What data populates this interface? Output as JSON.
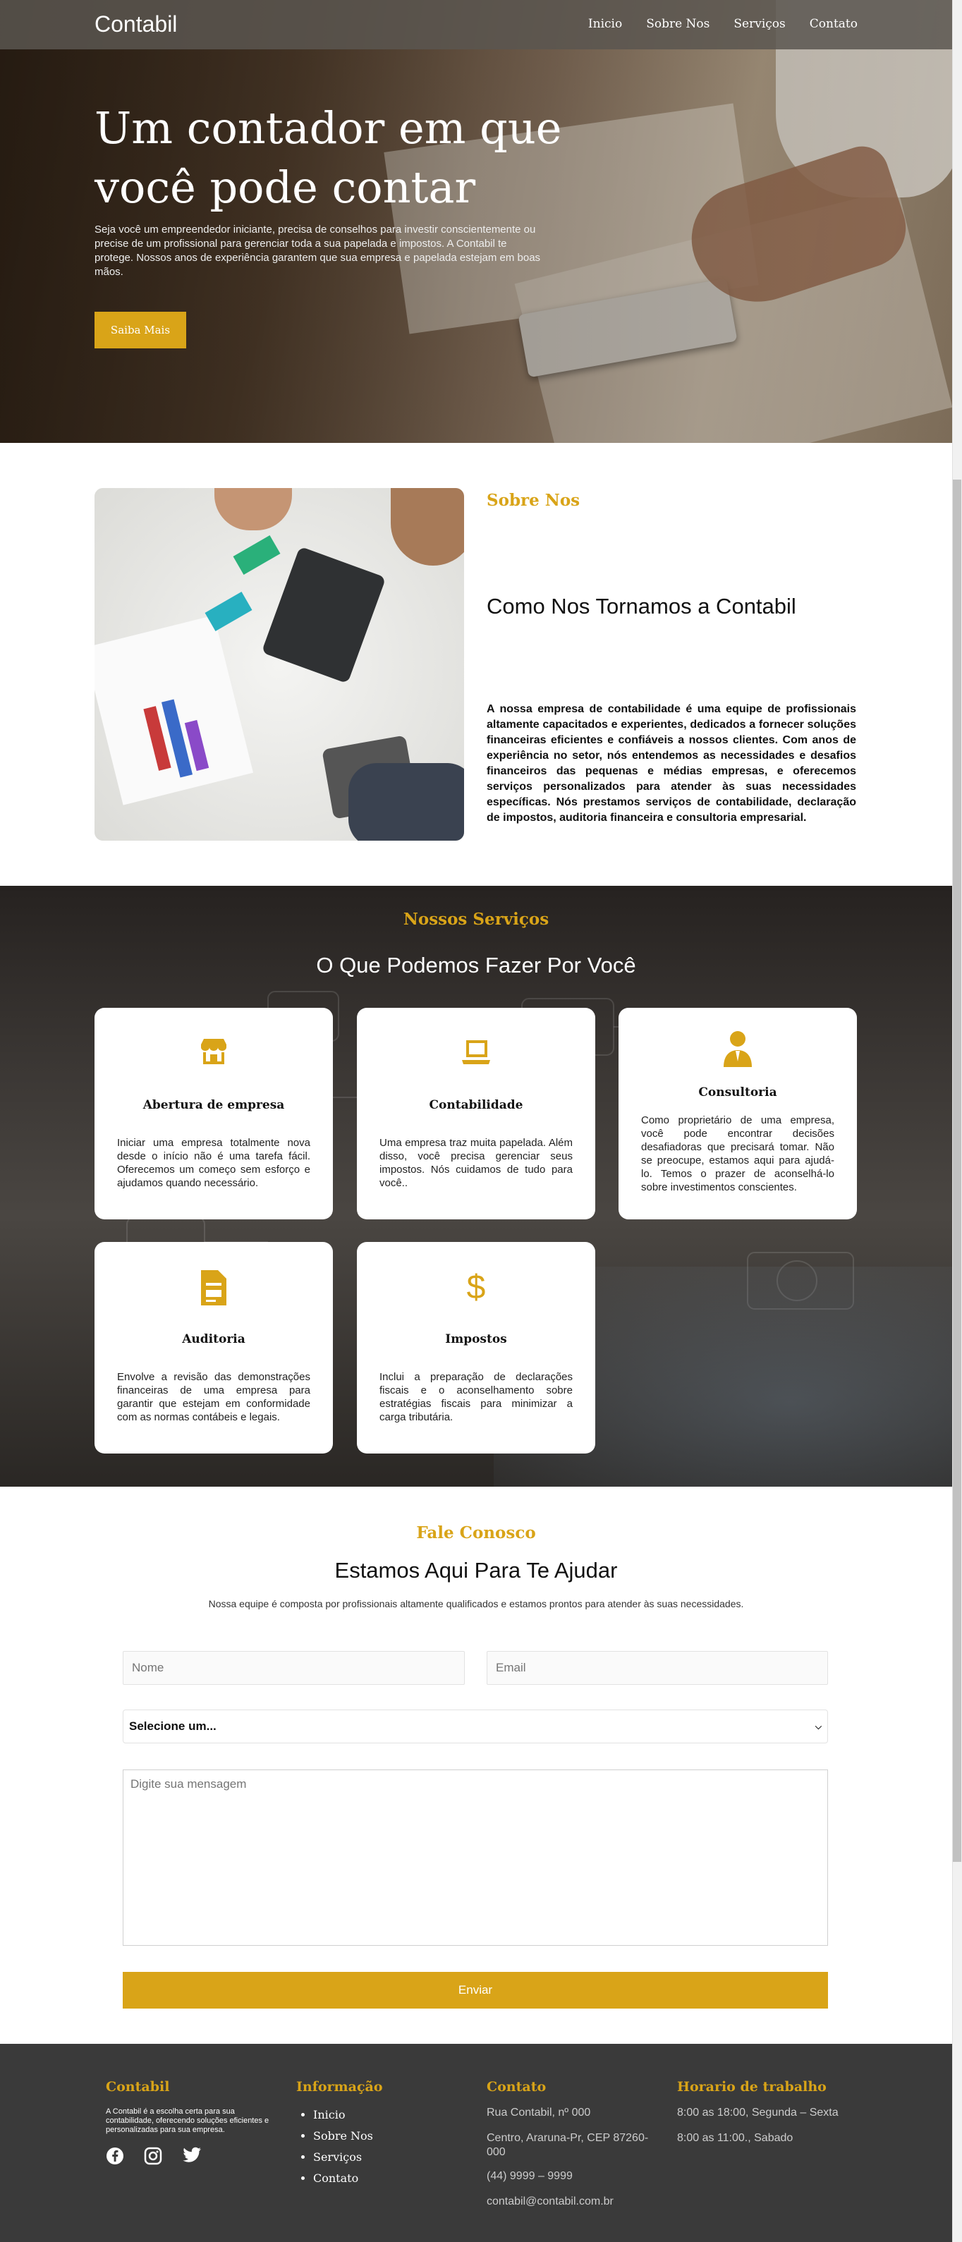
{
  "nav": {
    "brand": "Contabil",
    "links": [
      "Inicio",
      "Sobre Nos",
      "Serviços",
      "Contato"
    ]
  },
  "hero": {
    "title": "Um contador em que você pode contar",
    "text": "Seja você um empreendedor iniciante, precisa de conselhos para investir conscientemente ou precise de um profissional para gerenciar toda a sua papelada e impostos. A Contabil te protege. Nossos anos de experiência garantem que sua empresa e papelada estejam em boas mãos.",
    "button": "Saiba Mais"
  },
  "about": {
    "eyebrow": "Sobre Nos",
    "title": "Como Nos Tornamos a Contabil",
    "text": "A nossa empresa de contabilidade é uma equipe de profissionais altamente capacitados e experientes, dedicados a fornecer soluções financeiras eficientes e confiáveis a nossos clientes. Com anos de experiência no setor, nós entendemos as necessidades e desafios financeiros das pequenas e médias empresas, e oferecemos serviços personalizados para atender às suas necessidades específicas. Nós prestamos serviços de contabilidade, declaração de impostos, auditoria financeira e consultoria empresarial."
  },
  "services": {
    "eyebrow": "Nossos Serviços",
    "title": "O Que Podemos Fazer Por Você",
    "cards": [
      {
        "icon": "store-icon",
        "title": "Abertura de empresa",
        "text": "Iniciar uma empresa totalmente nova desde o início não é uma tarefa fácil. Oferecemos um começo sem esforço e ajudamos quando necessário."
      },
      {
        "icon": "laptop-icon",
        "title": "Contabilidade",
        "text": "Uma empresa traz muita papelada. Além disso, você precisa gerenciar seus impostos. Nós cuidamos de tudo para você.."
      },
      {
        "icon": "consultant-icon",
        "title": "Consultoria",
        "text": "Como proprietário de uma empresa, você pode encontrar decisões desafiadoras que precisará tomar. Não se preocupe, estamos aqui para ajudá-lo. Temos o prazer de aconselhá-lo sobre investimentos conscientes."
      },
      {
        "icon": "document-icon",
        "title": "Auditoria",
        "text": "Envolve a revisão das demonstrações financeiras de uma empresa para garantir que estejam em conformidade com as normas contábeis e legais."
      },
      {
        "icon": "dollar-icon",
        "title": "Impostos",
        "text": "Inclui a preparação de declarações fiscais e o aconselhamento sobre estratégias fiscais para minimizar a carga tributária."
      }
    ]
  },
  "contact": {
    "eyebrow": "Fale Conosco",
    "title": "Estamos Aqui Para Te Ajudar",
    "text": "Nossa equipe é composta por profissionais altamente qualificados e estamos prontos para atender às suas necessidades.",
    "name_placeholder": "Nome",
    "email_placeholder": "Email",
    "select_value": "Selecione um...",
    "message_placeholder": "Digite sua mensagem",
    "send": "Enviar"
  },
  "footer": {
    "brand_title": "Contabil",
    "brand_text": "A Contabil é a escolha certa para sua contabilidade, oferecendo soluções eficientes e personalizadas para sua empresa.",
    "info_title": "Informação",
    "info_links": [
      "Inicio",
      "Sobre Nos",
      "Serviços",
      "Contato"
    ],
    "contact_title": "Contato",
    "address1": "Rua Contabil, nº 000",
    "address2": "Centro, Araruna-Pr, CEP 87260-000",
    "phone": "(44) 9999 – 9999",
    "email": "contabil@contabil.com.br",
    "hours_title": "Horario de trabalho",
    "hours1": "8:00 as 18:00, Segunda – Sexta",
    "hours2": "8:00 as 11:00., Sabado"
  },
  "colors": {
    "accent": "#d9a418",
    "footer_bg": "#3a3a3a"
  }
}
